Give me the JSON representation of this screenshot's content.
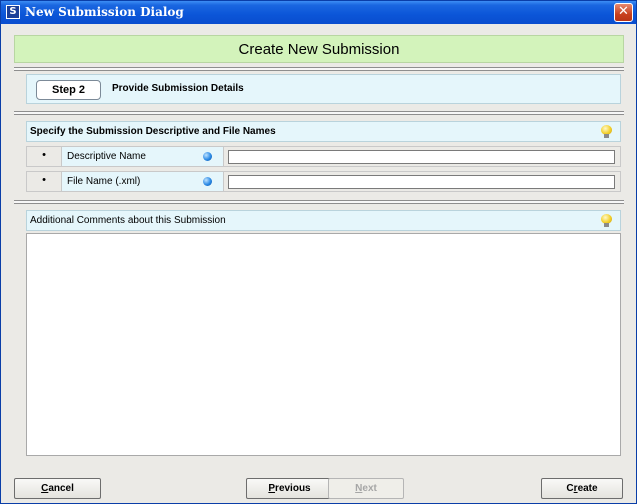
{
  "window": {
    "title": "New Submission Dialog",
    "app_icon_letter": "S",
    "close_glyph": "✕"
  },
  "header": {
    "title": "Create New Submission"
  },
  "step": {
    "label": "Step 2",
    "description": "Provide Submission Details"
  },
  "names_section": {
    "heading": "Specify the Submission Descriptive and File Names",
    "icon": "lightbulb-icon",
    "fields": [
      {
        "bullet": "•",
        "label": "Descriptive Name",
        "value": "",
        "required_icon": "blue-dot-icon"
      },
      {
        "bullet": "•",
        "label": "File Name (.xml)",
        "value": "",
        "required_icon": "blue-dot-icon"
      }
    ]
  },
  "comments_section": {
    "heading": "Additional Comments about this Submission",
    "icon": "lightbulb-icon",
    "value": ""
  },
  "buttons": {
    "cancel": {
      "mnemonic": "C",
      "rest": "ancel"
    },
    "previous": {
      "mnemonic": "P",
      "rest": "revious"
    },
    "next": {
      "mnemonic": "N",
      "rest": "ext",
      "disabled": true
    },
    "create": {
      "prefix": "C",
      "mnemonic": "r",
      "rest": "eate"
    }
  },
  "colors": {
    "titlebar": "#0b55d8",
    "header_band": "#d3f3bb",
    "section_band": "#e5f6fb",
    "window_bg": "#ebeae6"
  }
}
